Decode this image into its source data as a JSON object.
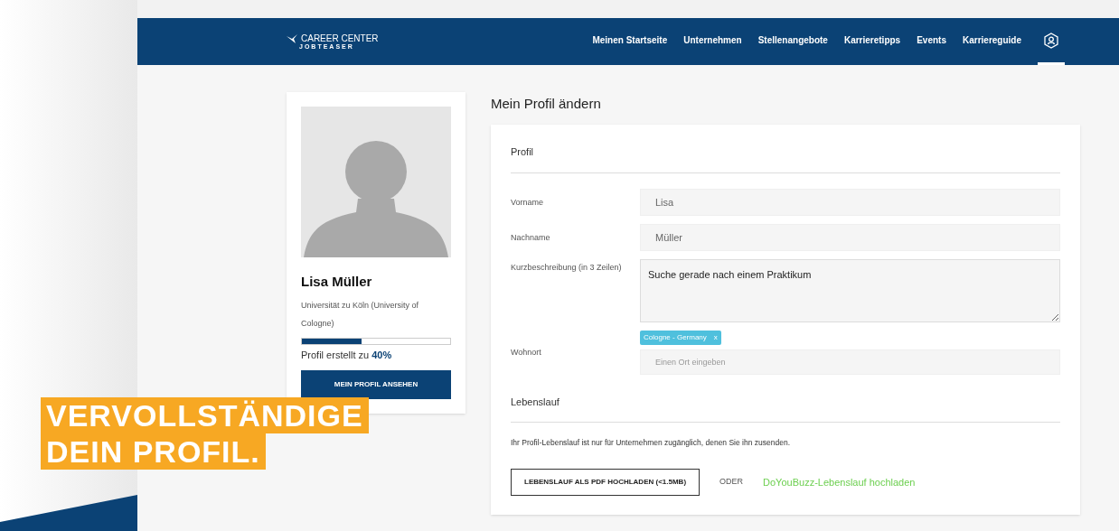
{
  "header": {
    "logo": {
      "line_1": "CAREER CENTER",
      "line_2": "JOBTEASER"
    },
    "nav": [
      {
        "label": "Meinen Startseite",
        "selected": false
      },
      {
        "label": "Unternehmen",
        "selected": false
      },
      {
        "label": "Stellenangebote",
        "selected": false
      },
      {
        "label": "Karrieretipps",
        "selected": false
      },
      {
        "label": "Events",
        "selected": false
      },
      {
        "label": "Karriereguide",
        "selected": false
      }
    ],
    "profile_icon": {
      "selected": true
    }
  },
  "profile_card": {
    "name": "Lisa Müller",
    "school": "Universität zu Köln (University of Cologne)",
    "progress": {
      "level": 0.4,
      "label": "Profil erstellt zu ",
      "value": "40%"
    },
    "button": "MEIN PROFIL ANSEHEN"
  },
  "page_title": "Mein Profil ändern",
  "form": {
    "section_1": "Profil",
    "fields": [
      {
        "kind": "input",
        "label": "Vorname",
        "value": "Lisa"
      },
      {
        "kind": "input",
        "label": "Nachname",
        "value": "Müller"
      },
      {
        "kind": "textarea",
        "label": "Kurzbeschreibung (in 3 Zeilen)",
        "value": "Suche gerade nach einem Praktikum"
      },
      {
        "kind": "tags",
        "label": "Wohnort",
        "tags": [
          {
            "label": "Cologne - Germany",
            "remove": "x"
          }
        ],
        "placeholder": "Einen Ort eingeben"
      }
    ],
    "section_2": "Lebenslauf",
    "note": "Ihr Profil-Lebenslauf ist nur für Unternehmen zugänglich, denen Sie ihn zusenden.",
    "upload_button": "LEBENSLAUF ALS PDF HOCHLADEN (<1.5MB)",
    "or": "ODER",
    "link": "DoYouBuzz-Lebenslauf hochladen"
  },
  "banner": {
    "lines": [
      "VERVOLLSTÄNDIGE",
      "DEIN PROFIL."
    ]
  }
}
